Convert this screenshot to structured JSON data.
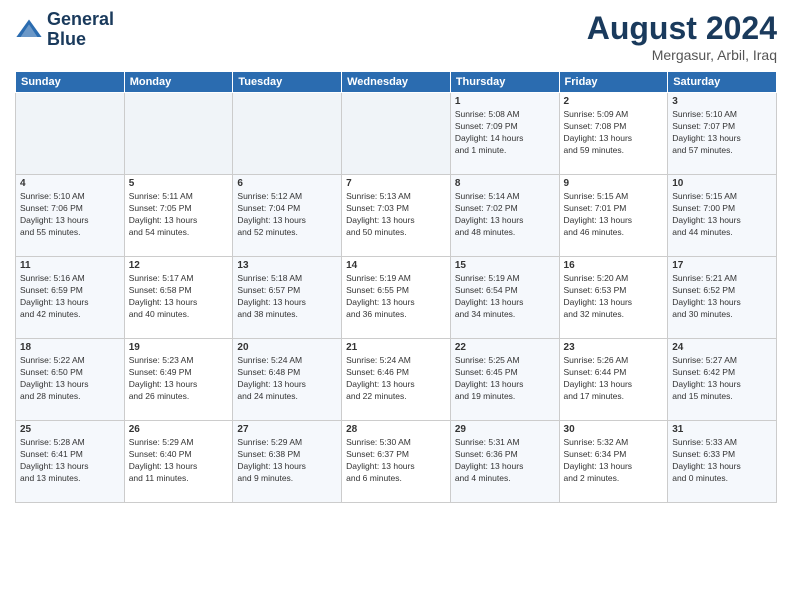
{
  "header": {
    "logo_line1": "General",
    "logo_line2": "Blue",
    "main_title": "August 2024",
    "subtitle": "Mergasur, Arbil, Iraq"
  },
  "weekdays": [
    "Sunday",
    "Monday",
    "Tuesday",
    "Wednesday",
    "Thursday",
    "Friday",
    "Saturday"
  ],
  "weeks": [
    [
      {
        "day": "",
        "info": ""
      },
      {
        "day": "",
        "info": ""
      },
      {
        "day": "",
        "info": ""
      },
      {
        "day": "",
        "info": ""
      },
      {
        "day": "1",
        "info": "Sunrise: 5:08 AM\nSunset: 7:09 PM\nDaylight: 14 hours\nand 1 minute."
      },
      {
        "day": "2",
        "info": "Sunrise: 5:09 AM\nSunset: 7:08 PM\nDaylight: 13 hours\nand 59 minutes."
      },
      {
        "day": "3",
        "info": "Sunrise: 5:10 AM\nSunset: 7:07 PM\nDaylight: 13 hours\nand 57 minutes."
      }
    ],
    [
      {
        "day": "4",
        "info": "Sunrise: 5:10 AM\nSunset: 7:06 PM\nDaylight: 13 hours\nand 55 minutes."
      },
      {
        "day": "5",
        "info": "Sunrise: 5:11 AM\nSunset: 7:05 PM\nDaylight: 13 hours\nand 54 minutes."
      },
      {
        "day": "6",
        "info": "Sunrise: 5:12 AM\nSunset: 7:04 PM\nDaylight: 13 hours\nand 52 minutes."
      },
      {
        "day": "7",
        "info": "Sunrise: 5:13 AM\nSunset: 7:03 PM\nDaylight: 13 hours\nand 50 minutes."
      },
      {
        "day": "8",
        "info": "Sunrise: 5:14 AM\nSunset: 7:02 PM\nDaylight: 13 hours\nand 48 minutes."
      },
      {
        "day": "9",
        "info": "Sunrise: 5:15 AM\nSunset: 7:01 PM\nDaylight: 13 hours\nand 46 minutes."
      },
      {
        "day": "10",
        "info": "Sunrise: 5:15 AM\nSunset: 7:00 PM\nDaylight: 13 hours\nand 44 minutes."
      }
    ],
    [
      {
        "day": "11",
        "info": "Sunrise: 5:16 AM\nSunset: 6:59 PM\nDaylight: 13 hours\nand 42 minutes."
      },
      {
        "day": "12",
        "info": "Sunrise: 5:17 AM\nSunset: 6:58 PM\nDaylight: 13 hours\nand 40 minutes."
      },
      {
        "day": "13",
        "info": "Sunrise: 5:18 AM\nSunset: 6:57 PM\nDaylight: 13 hours\nand 38 minutes."
      },
      {
        "day": "14",
        "info": "Sunrise: 5:19 AM\nSunset: 6:55 PM\nDaylight: 13 hours\nand 36 minutes."
      },
      {
        "day": "15",
        "info": "Sunrise: 5:19 AM\nSunset: 6:54 PM\nDaylight: 13 hours\nand 34 minutes."
      },
      {
        "day": "16",
        "info": "Sunrise: 5:20 AM\nSunset: 6:53 PM\nDaylight: 13 hours\nand 32 minutes."
      },
      {
        "day": "17",
        "info": "Sunrise: 5:21 AM\nSunset: 6:52 PM\nDaylight: 13 hours\nand 30 minutes."
      }
    ],
    [
      {
        "day": "18",
        "info": "Sunrise: 5:22 AM\nSunset: 6:50 PM\nDaylight: 13 hours\nand 28 minutes."
      },
      {
        "day": "19",
        "info": "Sunrise: 5:23 AM\nSunset: 6:49 PM\nDaylight: 13 hours\nand 26 minutes."
      },
      {
        "day": "20",
        "info": "Sunrise: 5:24 AM\nSunset: 6:48 PM\nDaylight: 13 hours\nand 24 minutes."
      },
      {
        "day": "21",
        "info": "Sunrise: 5:24 AM\nSunset: 6:46 PM\nDaylight: 13 hours\nand 22 minutes."
      },
      {
        "day": "22",
        "info": "Sunrise: 5:25 AM\nSunset: 6:45 PM\nDaylight: 13 hours\nand 19 minutes."
      },
      {
        "day": "23",
        "info": "Sunrise: 5:26 AM\nSunset: 6:44 PM\nDaylight: 13 hours\nand 17 minutes."
      },
      {
        "day": "24",
        "info": "Sunrise: 5:27 AM\nSunset: 6:42 PM\nDaylight: 13 hours\nand 15 minutes."
      }
    ],
    [
      {
        "day": "25",
        "info": "Sunrise: 5:28 AM\nSunset: 6:41 PM\nDaylight: 13 hours\nand 13 minutes."
      },
      {
        "day": "26",
        "info": "Sunrise: 5:29 AM\nSunset: 6:40 PM\nDaylight: 13 hours\nand 11 minutes."
      },
      {
        "day": "27",
        "info": "Sunrise: 5:29 AM\nSunset: 6:38 PM\nDaylight: 13 hours\nand 9 minutes."
      },
      {
        "day": "28",
        "info": "Sunrise: 5:30 AM\nSunset: 6:37 PM\nDaylight: 13 hours\nand 6 minutes."
      },
      {
        "day": "29",
        "info": "Sunrise: 5:31 AM\nSunset: 6:36 PM\nDaylight: 13 hours\nand 4 minutes."
      },
      {
        "day": "30",
        "info": "Sunrise: 5:32 AM\nSunset: 6:34 PM\nDaylight: 13 hours\nand 2 minutes."
      },
      {
        "day": "31",
        "info": "Sunrise: 5:33 AM\nSunset: 6:33 PM\nDaylight: 13 hours\nand 0 minutes."
      }
    ]
  ]
}
